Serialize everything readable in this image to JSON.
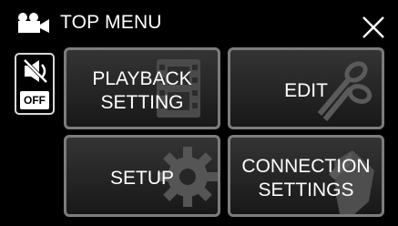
{
  "header": {
    "title": "TOP MENU",
    "camera_icon": "movie-camera-icon",
    "close_icon": "close-icon"
  },
  "mute_toggle": {
    "icon": "sound-muted-icon",
    "state_label": "OFF"
  },
  "tiles": [
    {
      "line1": "PLAYBACK",
      "line2": "SETTING",
      "icon": "film-strip-icon"
    },
    {
      "line1": "EDIT",
      "icon": "scissors-icon"
    },
    {
      "line1": "SETUP",
      "icon": "gear-icon"
    },
    {
      "line1": "CONNECTION",
      "line2": "SETTINGS",
      "icon": "hand-icon"
    }
  ],
  "colors": {
    "background": "#000000",
    "tile_border": "#7c7c7c",
    "text": "#ffffff"
  }
}
